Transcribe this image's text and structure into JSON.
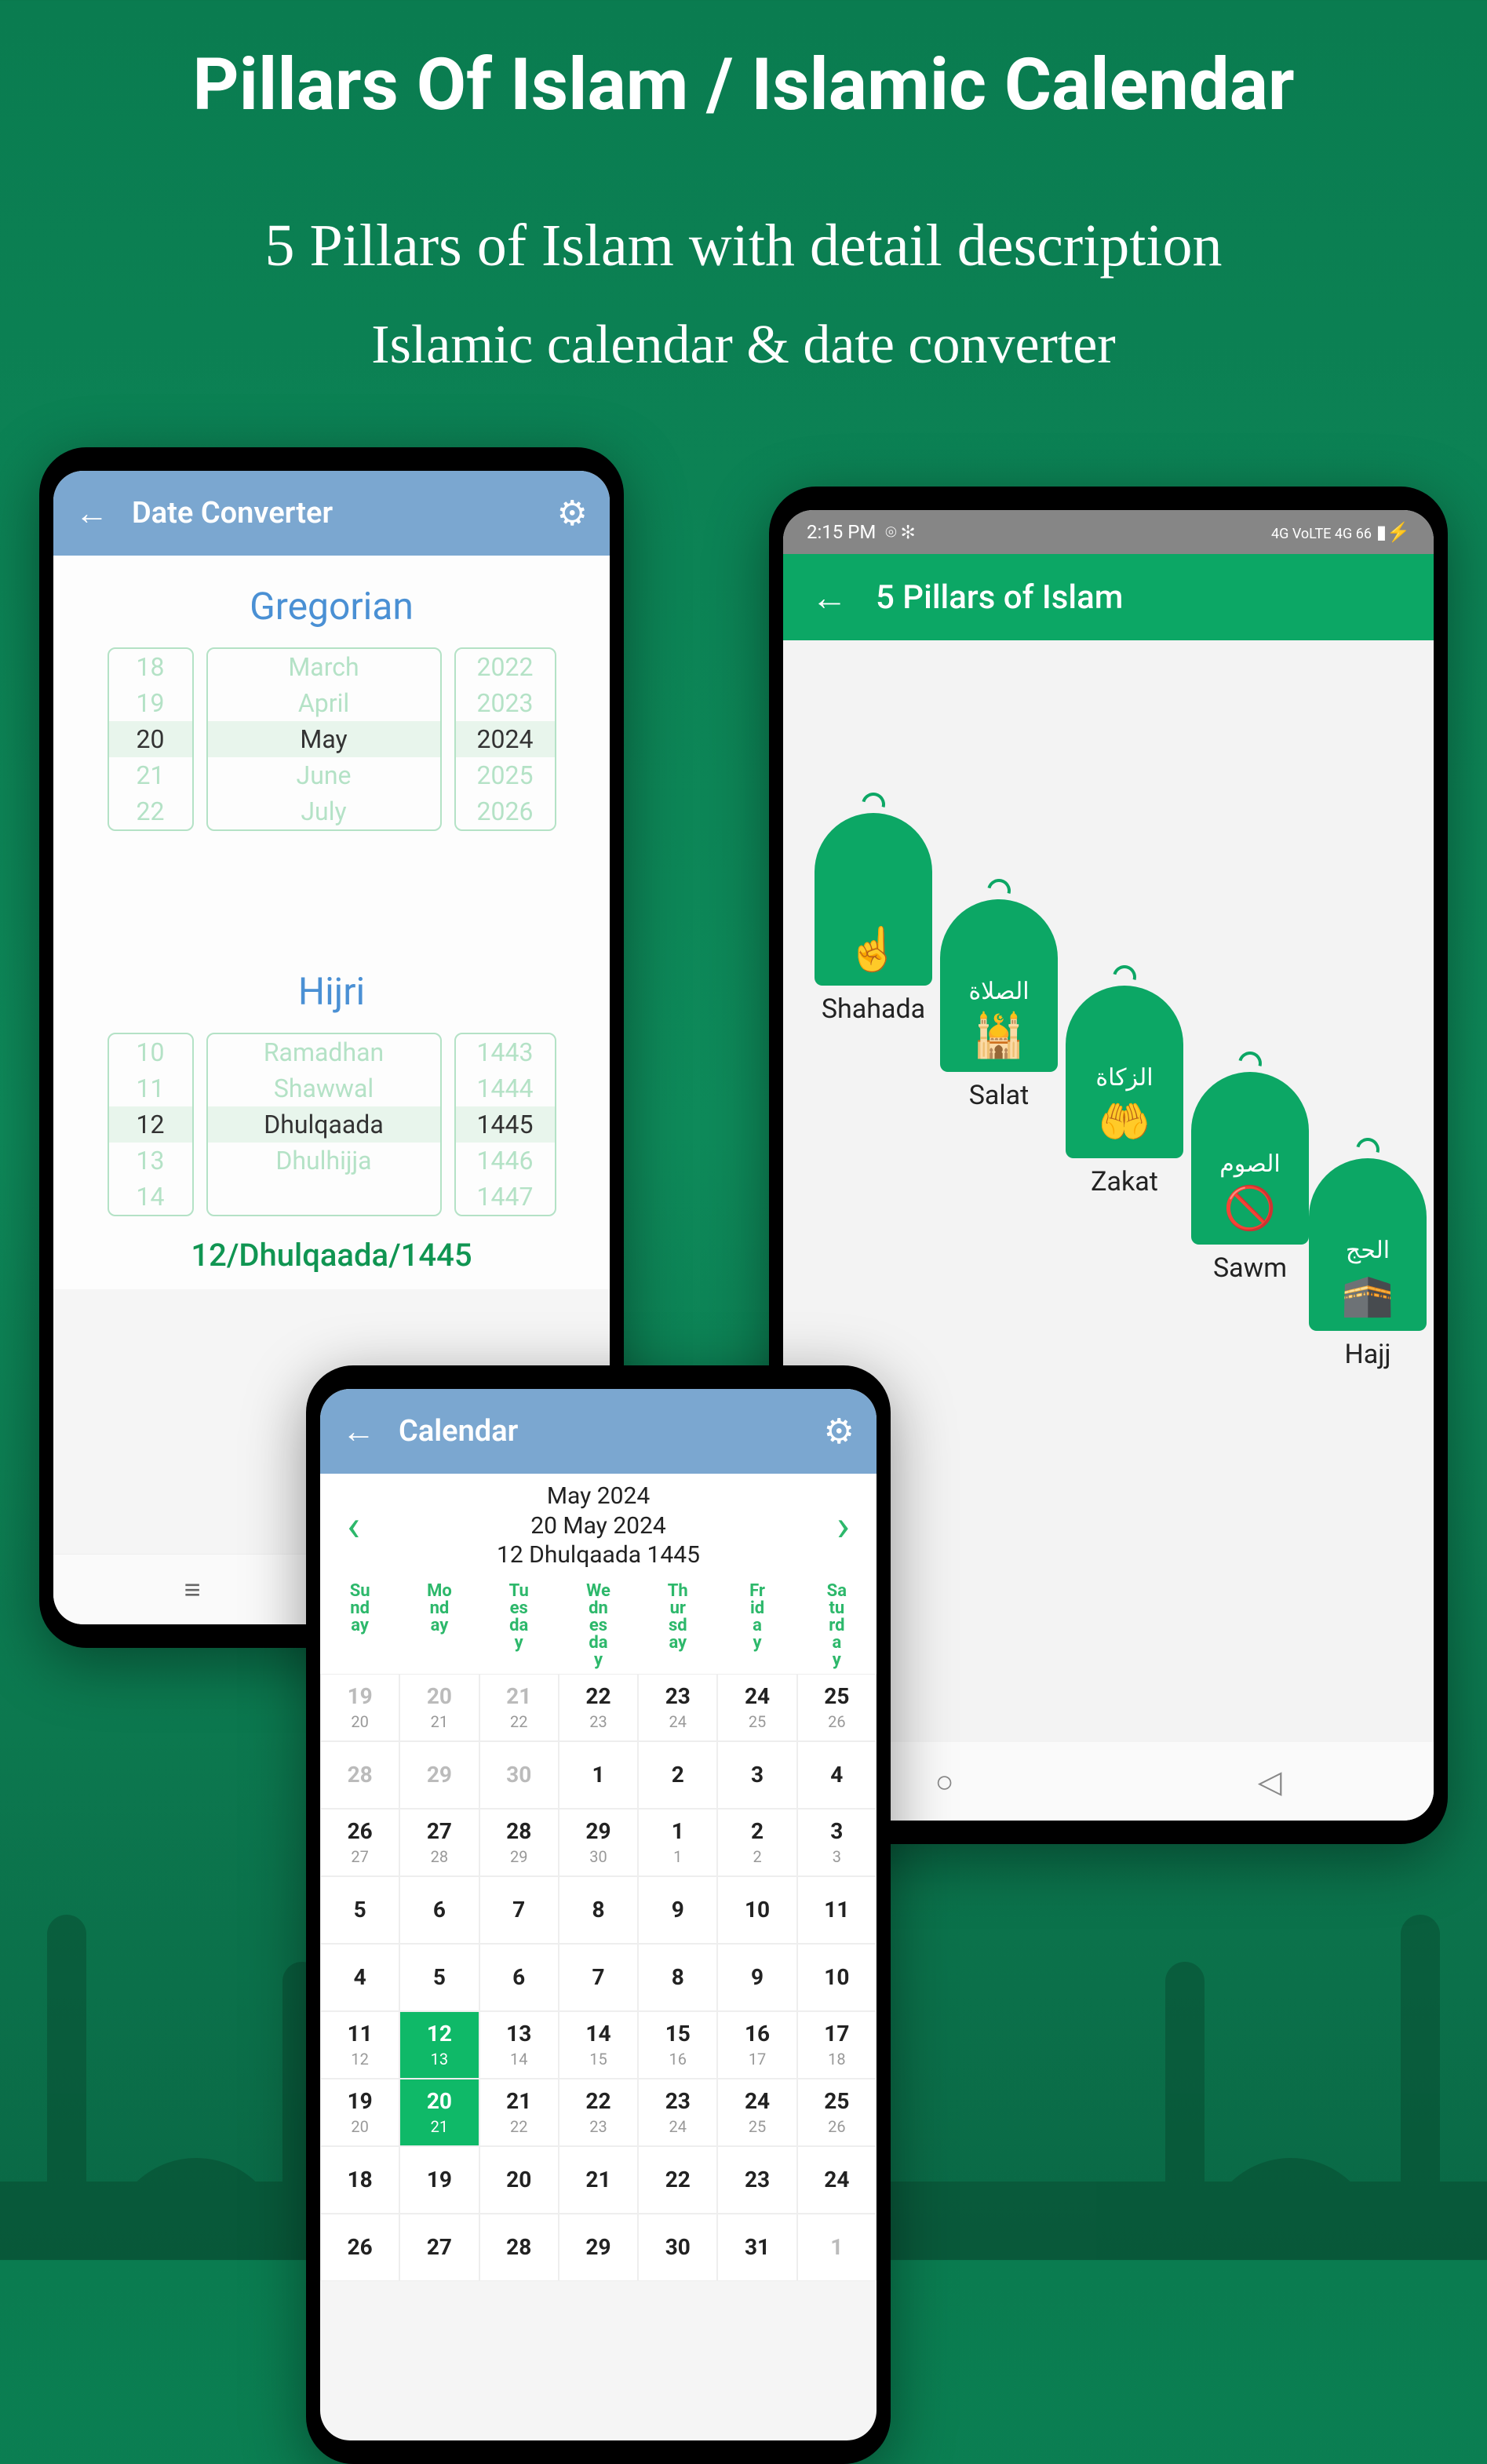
{
  "hero": {
    "title": "Pillars Of Islam / Islamic Calendar",
    "sub1": "5 Pillars of Islam with detail description",
    "sub2": "Islamic calendar & date converter"
  },
  "phone1": {
    "title": "Date Converter",
    "gregorian_label": "Gregorian",
    "hijri_label": "Hijri",
    "greg_days": [
      "18",
      "19",
      "20",
      "21",
      "22"
    ],
    "greg_months": [
      "March",
      "April",
      "May",
      "June",
      "July"
    ],
    "greg_years": [
      "2022",
      "2023",
      "2024",
      "2025",
      "2026"
    ],
    "hijri_days": [
      "10",
      "11",
      "12",
      "13",
      "14"
    ],
    "hijri_months": [
      "Ramadhan",
      "Shawwal",
      "Dhulqaada",
      "Dhulhijja",
      ""
    ],
    "hijri_years": [
      "1443",
      "1444",
      "1445",
      "1446",
      "1447"
    ],
    "result": "12/Dhulqaada/1445"
  },
  "phone2": {
    "status_time": "2:15 PM",
    "status_right": "4G  VoLTE  4G  66",
    "title": "5 Pillars of Islam",
    "pillars": {
      "p0": {
        "label": "Shahada",
        "arabic": ""
      },
      "p1": {
        "label": "Salat",
        "arabic": "الصلاة"
      },
      "p2": {
        "label": "Zakat",
        "arabic": "الزكاة"
      },
      "p3": {
        "label": "Sawm",
        "arabic": "الصوم"
      },
      "p4": {
        "label": "Hajj",
        "arabic": "الحج"
      }
    }
  },
  "phone3": {
    "title": "Calendar",
    "header_month": "May 2024",
    "header_greg": "20 May 2024",
    "header_hijri": "12 Dhulqaada 1445",
    "dow": [
      "Su\nnd\nay",
      "Mo\nnd\nay",
      "Tu\nes\nda\ny",
      "We\ndn\nes\nda\ny",
      "Th\nur\nsd\nay",
      "Fr\nid\na\ny",
      "Sa\ntu\nrd\na\ny"
    ],
    "weeks": [
      [
        {
          "g": "19",
          "h": "20",
          "dim": true
        },
        {
          "g": "20",
          "h": "21",
          "dim": true
        },
        {
          "g": "21",
          "h": "22",
          "dim": true
        },
        {
          "g": "22",
          "h": "23"
        },
        {
          "g": "23",
          "h": "24"
        },
        {
          "g": "24",
          "h": "25"
        },
        {
          "g": "25",
          "h": "26"
        }
      ],
      [
        {
          "g": "28",
          "h": "",
          "dim": true
        },
        {
          "g": "29",
          "h": "",
          "dim": true
        },
        {
          "g": "30",
          "h": "",
          "dim": true
        },
        {
          "g": "1",
          "h": ""
        },
        {
          "g": "2",
          "h": ""
        },
        {
          "g": "3",
          "h": ""
        },
        {
          "g": "4",
          "h": ""
        }
      ],
      [
        {
          "g": "26",
          "h": "27"
        },
        {
          "g": "27",
          "h": "28"
        },
        {
          "g": "28",
          "h": "29"
        },
        {
          "g": "29",
          "h": "30"
        },
        {
          "g": "1",
          "h": "1"
        },
        {
          "g": "2",
          "h": "2"
        },
        {
          "g": "3",
          "h": "3"
        }
      ],
      [
        {
          "g": "5",
          "h": ""
        },
        {
          "g": "6",
          "h": ""
        },
        {
          "g": "7",
          "h": ""
        },
        {
          "g": "8",
          "h": ""
        },
        {
          "g": "9",
          "h": ""
        },
        {
          "g": "10",
          "h": ""
        },
        {
          "g": "11",
          "h": ""
        }
      ],
      [
        {
          "g": "4",
          "h": ""
        },
        {
          "g": "5",
          "h": ""
        },
        {
          "g": "6",
          "h": ""
        },
        {
          "g": "7",
          "h": ""
        },
        {
          "g": "8",
          "h": ""
        },
        {
          "g": "9",
          "h": ""
        },
        {
          "g": "10",
          "h": ""
        }
      ],
      [
        {
          "g": "11",
          "h": "12"
        },
        {
          "g": "12",
          "h": "13",
          "sel": true
        },
        {
          "g": "13",
          "h": "14"
        },
        {
          "g": "14",
          "h": "15"
        },
        {
          "g": "15",
          "h": "16"
        },
        {
          "g": "16",
          "h": "17"
        },
        {
          "g": "17",
          "h": "18"
        }
      ],
      [
        {
          "g": "19",
          "h": "20"
        },
        {
          "g": "20",
          "h": "21",
          "sel": true
        },
        {
          "g": "21",
          "h": "22"
        },
        {
          "g": "22",
          "h": "23"
        },
        {
          "g": "23",
          "h": "24"
        },
        {
          "g": "24",
          "h": "25"
        },
        {
          "g": "25",
          "h": "26"
        }
      ],
      [
        {
          "g": "18",
          "h": ""
        },
        {
          "g": "19",
          "h": ""
        },
        {
          "g": "20",
          "h": ""
        },
        {
          "g": "21",
          "h": ""
        },
        {
          "g": "22",
          "h": ""
        },
        {
          "g": "23",
          "h": ""
        },
        {
          "g": "24",
          "h": ""
        }
      ],
      [
        {
          "g": "26",
          "h": ""
        },
        {
          "g": "27",
          "h": ""
        },
        {
          "g": "28",
          "h": ""
        },
        {
          "g": "29",
          "h": ""
        },
        {
          "g": "30",
          "h": ""
        },
        {
          "g": "31",
          "h": ""
        },
        {
          "g": "1",
          "h": "",
          "dim": true
        }
      ]
    ]
  }
}
